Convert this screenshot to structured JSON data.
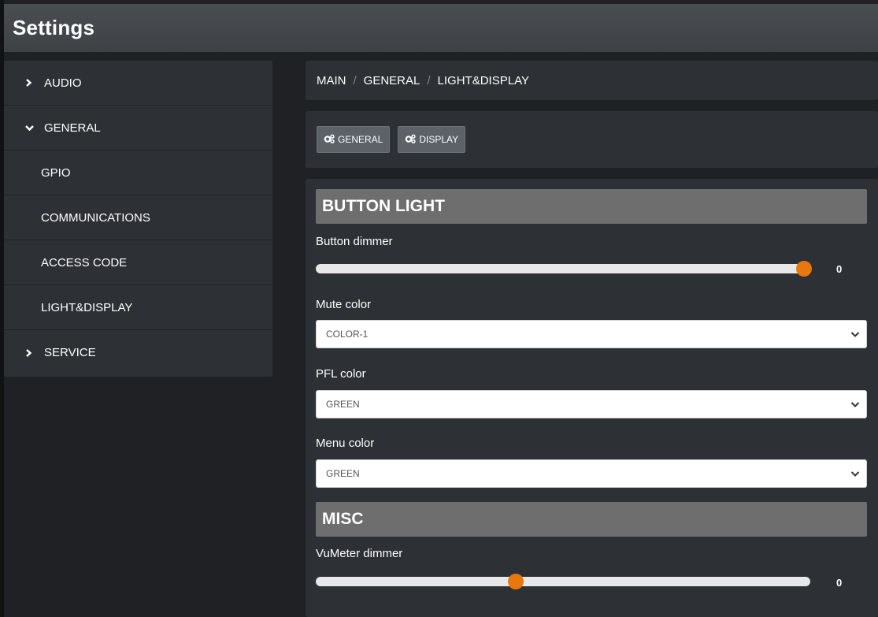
{
  "app": {
    "title": "Settings"
  },
  "sidebar": {
    "items": [
      {
        "label": "AUDIO",
        "type": "parent",
        "icon": "chevron-right-icon"
      },
      {
        "label": "GENERAL",
        "type": "parent",
        "icon": "chevron-down-icon"
      },
      {
        "label": "GPIO",
        "type": "child"
      },
      {
        "label": "COMMUNICATIONS",
        "type": "child"
      },
      {
        "label": "ACCESS CODE",
        "type": "child"
      },
      {
        "label": "LIGHT&DISPLAY",
        "type": "child"
      },
      {
        "label": "SERVICE",
        "type": "parent",
        "icon": "chevron-right-icon"
      }
    ]
  },
  "breadcrumb": {
    "items": [
      "MAIN",
      "GENERAL",
      "LIGHT&DISPLAY"
    ],
    "separator": "/"
  },
  "toolbar": {
    "general_label": "GENERAL",
    "display_label": "DISPLAY",
    "icon": "cogs-icon"
  },
  "button_light": {
    "heading": "BUTTON LIGHT",
    "dimmer_label": "Button dimmer",
    "dimmer_value": "0",
    "dimmer_level": 1.0,
    "mute_label": "Mute color",
    "mute_value": "COLOR-1",
    "pfl_label": "PFL color",
    "pfl_value": "GREEN",
    "menu_label": "Menu color",
    "menu_value": "GREEN"
  },
  "misc": {
    "heading": "MISC",
    "vumeter_label": "VuMeter dimmer",
    "vumeter_value": "0",
    "vumeter_level": 0.4
  },
  "colors": {
    "accent": "#e8770d",
    "background": "#1f2124",
    "panel": "#2d3135",
    "section_header": "#6e6e6e",
    "button": "#5c6268"
  }
}
